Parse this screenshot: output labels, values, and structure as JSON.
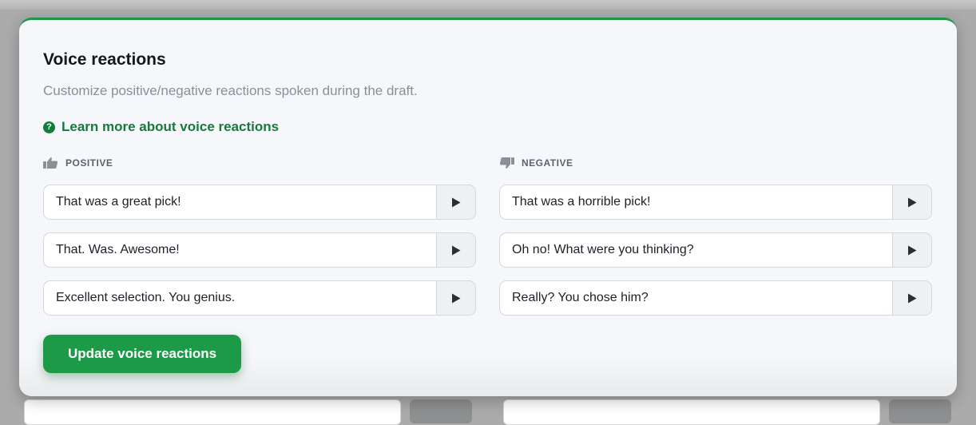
{
  "section": {
    "title": "Voice reactions",
    "description": "Customize positive/negative reactions spoken during the draft.",
    "learn_more": "Learn more about voice reactions",
    "learn_icon": "?"
  },
  "positive": {
    "header": "POSITIVE",
    "icon": "thumbs-up-icon",
    "reactions": [
      "That was a great pick!",
      "That. Was. Awesome!",
      "Excellent selection. You genius."
    ]
  },
  "negative": {
    "header": "NEGATIVE",
    "icon": "thumbs-down-icon",
    "reactions": [
      "That was a horrible pick!",
      "Oh no! What were you thinking?",
      "Really? You chose him?"
    ]
  },
  "actions": {
    "update_label": "Update voice reactions"
  },
  "colors": {
    "accent": "#1c9a47",
    "link": "#157a3c"
  }
}
